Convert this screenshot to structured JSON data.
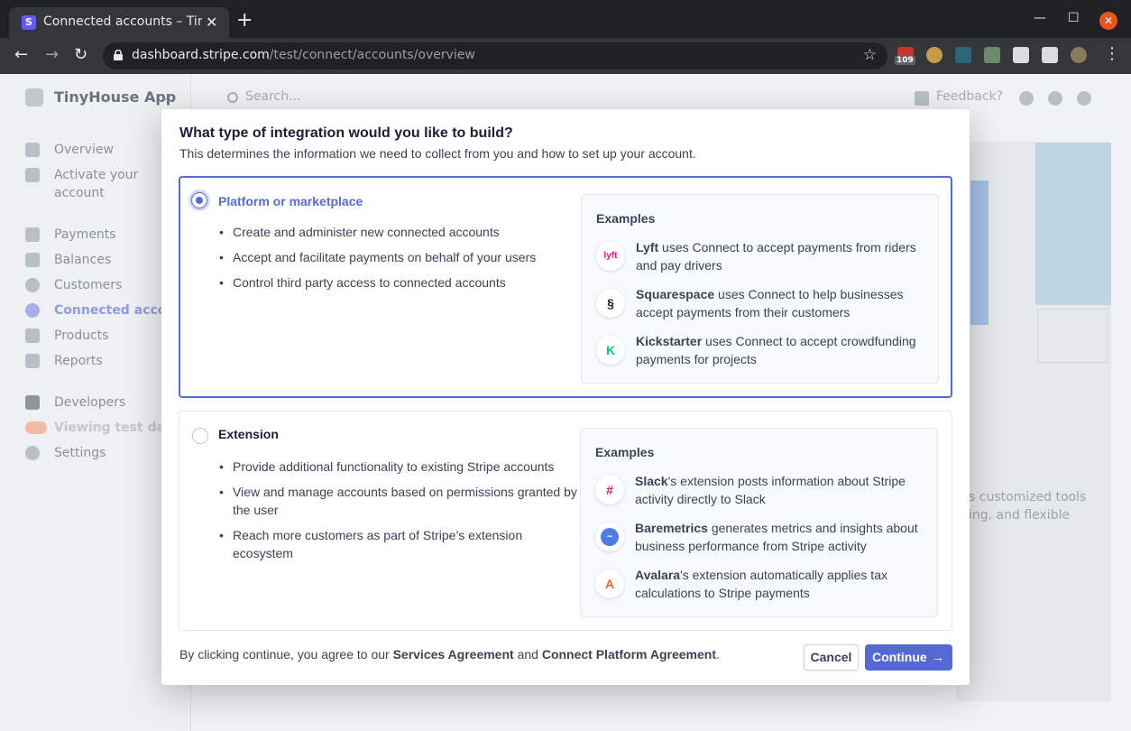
{
  "browser": {
    "tab_title": "Connected accounts – Tin",
    "url_host": "dashboard.stripe.com",
    "url_path": "/test/connect/accounts/overview",
    "ext_badge": "109"
  },
  "page": {
    "app_name": "TinyHouse App",
    "search_placeholder": "Search...",
    "feedback": "Feedback?",
    "sidebar": [
      {
        "label": "Overview"
      },
      {
        "label": "Activate your"
      },
      {
        "label": "account"
      },
      {
        "label": "Payments"
      },
      {
        "label": "Balances"
      },
      {
        "label": "Customers"
      },
      {
        "label": "Connected accoun"
      },
      {
        "label": "Products"
      },
      {
        "label": "Reports"
      },
      {
        "label": "Developers"
      },
      {
        "label": "Viewing test data"
      },
      {
        "label": "Settings"
      }
    ],
    "bg_text_1": "s customized tools",
    "bg_text_2": "ing, and flexible"
  },
  "modal": {
    "title": "What type of integration would you like to build?",
    "subtitle": "This determines the information we need to collect from you and how to set up your account.",
    "options": [
      {
        "title": "Platform or marketplace",
        "selected": true,
        "bullets": [
          "Create and administer new connected accounts",
          "Accept and facilitate payments on behalf of your users",
          "Control third party access to connected accounts"
        ],
        "examples_heading": "Examples",
        "examples": [
          {
            "name": "Lyft",
            "text": " uses Connect to accept payments from riders and pay drivers",
            "logo": "lyft-logo-icon"
          },
          {
            "name": "Squarespace",
            "text": " uses Connect to help businesses accept payments from their customers",
            "logo": "squarespace-logo-icon"
          },
          {
            "name": "Kickstarter",
            "text": " uses Connect to accept crowdfunding payments for projects",
            "logo": "kickstarter-logo-icon"
          }
        ]
      },
      {
        "title": "Extension",
        "selected": false,
        "bullets": [
          "Provide additional functionality to existing Stripe accounts",
          "View and manage accounts based on permissions granted by the user",
          "Reach more customers as part of Stripe’s extension ecosystem"
        ],
        "examples_heading": "Examples",
        "examples": [
          {
            "name": "Slack",
            "text": "'s extension posts information about Stripe activity directly to Slack",
            "logo": "slack-logo-icon"
          },
          {
            "name": "Baremetrics",
            "text": " generates metrics and insights about business performance from Stripe activity",
            "logo": "baremetrics-logo-icon"
          },
          {
            "name": "Avalara",
            "text": "'s extension automatically applies tax calculations to Stripe payments",
            "logo": "avalara-logo-icon"
          }
        ]
      }
    ],
    "footer": {
      "prefix": "By clicking continue, you agree to our ",
      "link1": "Services Agreement",
      "mid": " and ",
      "link2": "Connect Platform Agreement",
      "suffix": "."
    },
    "cancel_label": "Cancel",
    "continue_label": "Continue",
    "accent_color": "#556cd6"
  }
}
